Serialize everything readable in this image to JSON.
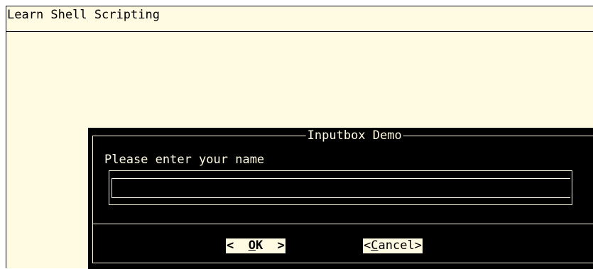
{
  "backtitle": "Learn Shell Scripting",
  "dialog": {
    "title": "Inputbox Demo",
    "prompt": "Please enter your name",
    "input_value": "",
    "ok": {
      "left": "<  ",
      "hot": "O",
      "rest": "K  >"
    },
    "cancel": {
      "left": "<",
      "hot": "C",
      "rest": "ancel>"
    }
  },
  "colors": {
    "screen_bg": "#fffbe2",
    "dialog_bg": "#000000",
    "text_light": "#fffbe2"
  }
}
